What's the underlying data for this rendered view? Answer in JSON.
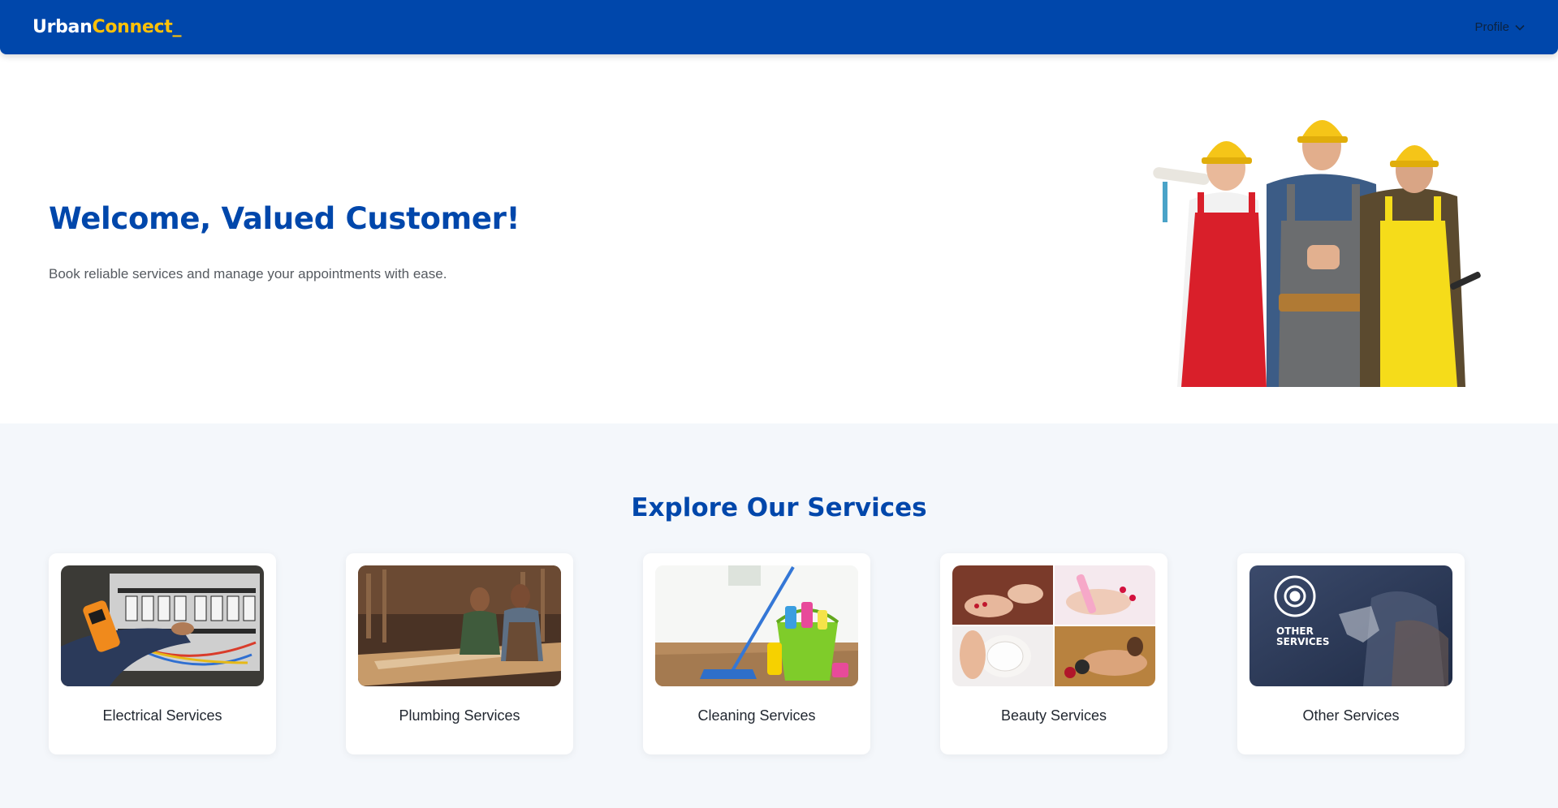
{
  "navbar": {
    "logo_part1": "Urban",
    "logo_part2": "Connect_",
    "profile_label": "Profile",
    "background_color": "#0047ab",
    "accent_color": "#ffc107"
  },
  "hero": {
    "title": "Welcome, Valued Customer!",
    "subtitle": "Book reliable services and manage your appointments with ease.",
    "image": "three-workers-in-hard-hats"
  },
  "services": {
    "title": "Explore Our Services",
    "items": [
      {
        "label": "Electrical Services",
        "image": "electrician-testing-panel"
      },
      {
        "label": "Plumbing Services",
        "image": "workers-in-workshop"
      },
      {
        "label": "Cleaning Services",
        "image": "mop-and-bucket"
      },
      {
        "label": "Beauty Services",
        "image": "spa-and-nails-collage"
      },
      {
        "label": "Other Services",
        "image": "gear-and-puzzle",
        "image_text_line1": "OTHER",
        "image_text_line2": "SERVICES"
      }
    ]
  }
}
